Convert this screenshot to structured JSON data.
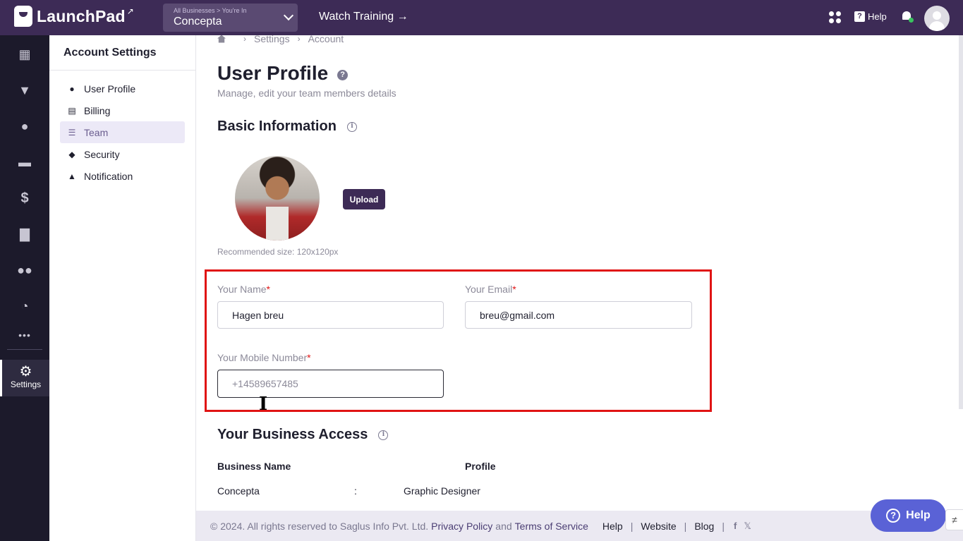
{
  "topbar": {
    "brand": "LaunchPad",
    "business_crumb": "All Businesses > You're In",
    "business_name": "Concepta",
    "watch_training": "Watch Training →",
    "help_label": "Help"
  },
  "rail": {
    "items": [
      "dashboard-icon",
      "funnel-icon",
      "globe-icon",
      "video-icon",
      "dollar-icon",
      "analytics-icon",
      "users-icon",
      "reports-icon",
      "more-icon"
    ],
    "settings_label": "Settings"
  },
  "account": {
    "title": "Account Settings",
    "items": [
      {
        "label": "User Profile",
        "icon": "user-icon"
      },
      {
        "label": "Billing",
        "icon": "billing-icon"
      },
      {
        "label": "Team",
        "icon": "team-icon",
        "active": true
      },
      {
        "label": "Security",
        "icon": "shield-icon"
      },
      {
        "label": "Notification",
        "icon": "bell-icon"
      }
    ]
  },
  "breadcrumb": {
    "settings": "Settings",
    "account": "Account",
    "sep": "›"
  },
  "page": {
    "title": "User Profile",
    "subtitle": "Manage, edit your team members details",
    "basic_info": "Basic Information",
    "upload": "Upload",
    "recommended": "Recommended size: 120x120px"
  },
  "form": {
    "name_label": "Your Name",
    "name_value": "Hagen breu",
    "email_label": "Your Email",
    "email_value": "breu@gmail.com",
    "mobile_label": "Your Mobile Number",
    "mobile_placeholder": "+14589657485",
    "required_mark": "*"
  },
  "business_access": {
    "title": "Your Business Access",
    "col_name": "Business Name",
    "col_profile": "Profile",
    "rows": [
      {
        "name": "Concepta",
        "sep": ":",
        "profile": "Graphic Designer"
      }
    ]
  },
  "footer": {
    "copyright": "©  2024. All rights reserved to Saglus Info Pvt. Ltd.",
    "privacy": "Privacy Policy",
    "and": "and",
    "terms": "Terms of Service",
    "links": [
      "Help",
      "Website",
      "Blog"
    ],
    "pipe": "|",
    "facebook": "f",
    "x": "𝕏"
  },
  "help_fab": "Help",
  "colors": {
    "brand": "#3d2b56",
    "rail": "#1c1a2b",
    "highlight": "#e01414",
    "fab": "#5a62d6"
  }
}
